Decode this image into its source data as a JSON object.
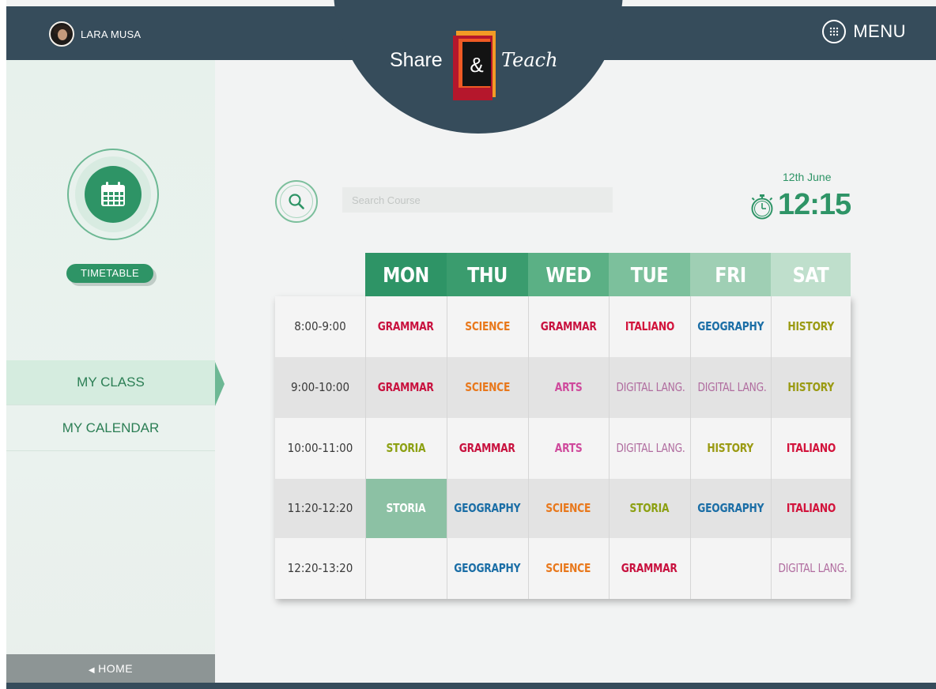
{
  "header": {
    "username": "LARA MUSA",
    "menu_label": "MENU",
    "logo": {
      "left": "Share",
      "center": "&",
      "right": "Teach"
    }
  },
  "sidebar": {
    "badge": "TIMETABLE",
    "nav": [
      {
        "label": "MY CLASS",
        "active": true
      },
      {
        "label": "MY CALENDAR",
        "active": false
      }
    ],
    "home_label": "HOME"
  },
  "search": {
    "placeholder": "Search Course",
    "value": ""
  },
  "datetime": {
    "date": "12th June",
    "time": "12:15"
  },
  "timetable": {
    "days": [
      "MON",
      "THU",
      "WED",
      "TUE",
      "FRI",
      "SAT"
    ],
    "day_colors": [
      "#2e9466",
      "#3a9c6e",
      "#5bb085",
      "#7cc09c",
      "#9fcfb4",
      "#bfdfcc"
    ],
    "slots": [
      "8:00-9:00",
      "9:00-10:00",
      "10:00-11:00",
      "11:20-12:20",
      "12:20-13:20"
    ],
    "cells": [
      [
        "GRAMMAR",
        "SCIENCE",
        "GRAMMAR",
        "ITALIANO",
        "GEOGRAPHY",
        "HISTORY"
      ],
      [
        "GRAMMAR",
        "SCIENCE",
        "ARTS",
        "DIGITAL LANG.",
        "DIGITAL LANG.",
        "HISTORY"
      ],
      [
        "STORIA",
        "GRAMMAR",
        "ARTS",
        "DIGITAL LANG.",
        "HISTORY",
        "ITALIANO"
      ],
      [
        "STORIA",
        "GEOGRAPHY",
        "SCIENCE",
        "STORIA",
        "GEOGRAPHY",
        "ITALIANO"
      ],
      [
        "",
        "GEOGRAPHY",
        "SCIENCE",
        "GRAMMAR",
        "",
        "DIGITAL LANG."
      ]
    ],
    "highlight": {
      "row": 3,
      "col": 0
    },
    "subject_colors": {
      "GRAMMAR": "#c8123f",
      "SCIENCE": "#e8781c",
      "ITALIANO": "#d2143c",
      "GEOGRAPHY": "#1b6ea6",
      "HISTORY": "#9a9a12",
      "ARTS": "#cf4a9c",
      "DIGITAL LANG.": "#b06c9f",
      "STORIA": "#8ca012"
    }
  }
}
